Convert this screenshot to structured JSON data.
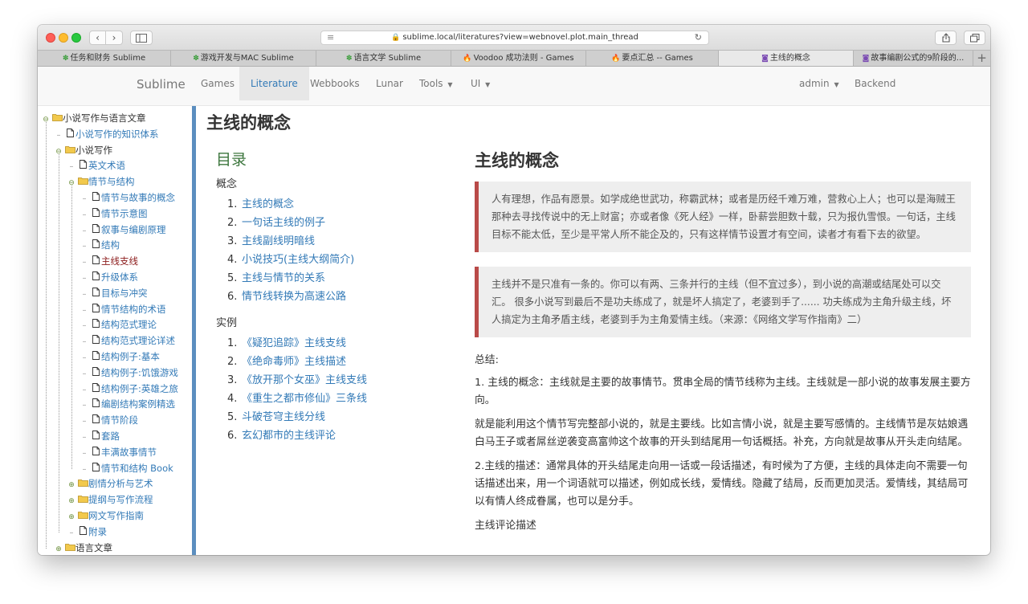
{
  "browser": {
    "url_prefix": "sublime.local",
    "url_path": "/literatures?view=webnovel.plot.main_thread",
    "tabs": [
      {
        "icon": "✽",
        "label": "任务和财务 Sublime",
        "active": false
      },
      {
        "icon": "✽",
        "label": "游戏开发与MAC Sublime",
        "active": false
      },
      {
        "icon": "✽",
        "label": "语言文学 Sublime",
        "active": false
      },
      {
        "icon": "🔥",
        "label": "Voodoo 成功法则 - Games",
        "active": false
      },
      {
        "icon": "🔥",
        "label": "要点汇总 -- Games",
        "active": false
      },
      {
        "icon": "◙",
        "label": "主线的概念",
        "active": true
      },
      {
        "icon": "◙",
        "label": "故事编剧公式的9阶段的...",
        "active": false
      }
    ],
    "new_tab": "+"
  },
  "navbar": {
    "brand": "Sublime",
    "items": [
      "Games",
      "Literature",
      "Webbooks",
      "Lunar",
      "Tools",
      "UI"
    ],
    "user": "admin",
    "backend": "Backend"
  },
  "tree": {
    "items": [
      {
        "label": "小说写作与语言文章",
        "type": "folder-open",
        "level": 0,
        "link": false
      },
      {
        "label": "小说写作的知识体系",
        "type": "file",
        "level": 1,
        "link": true
      },
      {
        "label": "小说写作",
        "type": "folder-open",
        "level": 1,
        "link": false
      },
      {
        "label": "英文术语",
        "type": "file",
        "level": 2,
        "link": true
      },
      {
        "label": "情节与结构",
        "type": "folder-open",
        "level": 2,
        "link": true
      },
      {
        "label": "情节与故事的概念",
        "type": "file",
        "level": 3,
        "link": true
      },
      {
        "label": "情节示意图",
        "type": "file",
        "level": 3,
        "link": true
      },
      {
        "label": "叙事与编剧原理",
        "type": "file",
        "level": 3,
        "link": true
      },
      {
        "label": "结构",
        "type": "file",
        "level": 3,
        "link": true
      },
      {
        "label": "主线支线",
        "type": "file",
        "level": 3,
        "link": true,
        "current": true
      },
      {
        "label": "升级体系",
        "type": "file",
        "level": 3,
        "link": true
      },
      {
        "label": "目标与冲突",
        "type": "file",
        "level": 3,
        "link": true
      },
      {
        "label": "情节结构的术语",
        "type": "file",
        "level": 3,
        "link": true
      },
      {
        "label": "结构范式理论",
        "type": "file",
        "level": 3,
        "link": true
      },
      {
        "label": "结构范式理论详述",
        "type": "file",
        "level": 3,
        "link": true
      },
      {
        "label": "结构例子:基本",
        "type": "file",
        "level": 3,
        "link": true
      },
      {
        "label": "结构例子:饥饿游戏",
        "type": "file",
        "level": 3,
        "link": true
      },
      {
        "label": "结构例子:英雄之旅",
        "type": "file",
        "level": 3,
        "link": true
      },
      {
        "label": "编剧结构案例精选",
        "type": "file",
        "level": 3,
        "link": true
      },
      {
        "label": "情节阶段",
        "type": "file",
        "level": 3,
        "link": true
      },
      {
        "label": "套路",
        "type": "file",
        "level": 3,
        "link": true
      },
      {
        "label": "丰满故事情节",
        "type": "file",
        "level": 3,
        "link": true
      },
      {
        "label": "情节和结构 Book",
        "type": "file",
        "level": 3,
        "link": true
      },
      {
        "label": "剧情分析与艺术",
        "type": "folder",
        "level": 2,
        "link": true
      },
      {
        "label": "提纲与写作流程",
        "type": "folder",
        "level": 2,
        "link": true
      },
      {
        "label": "网文写作指南",
        "type": "folder",
        "level": 2,
        "link": true
      },
      {
        "label": "附录",
        "type": "file",
        "level": 2,
        "link": true
      },
      {
        "label": "语言文章",
        "type": "folder",
        "level": 1,
        "link": false
      }
    ]
  },
  "page": {
    "title": "主线的概念"
  },
  "toc": {
    "title": "目录",
    "sections": [
      {
        "label": "概念",
        "items": [
          "主线的概念",
          "一句话主线的例子",
          "主线副线明暗线",
          "小说技巧(主线大纲简介)",
          "主线与情节的关系",
          "情节线转换为高速公路"
        ]
      },
      {
        "label": "实例",
        "items": [
          "《疑犯追踪》主线支线",
          "《绝命毒师》主线描述",
          "《放开那个女巫》主线支线",
          "《重生之都市修仙》三条线",
          "斗破苍穹主线分线",
          "玄幻都市的主线评论"
        ]
      }
    ]
  },
  "article": {
    "title": "主线的概念",
    "quotes": [
      "人有理想，作品有愿景。如学成绝世武功，称霸武林；或者是历经千难万难，营救心上人；也可以是海贼王那种去寻找传说中的无上财富；亦或者像《死人经》一样，卧薪尝胆数十载，只为报仇雪恨。一句话，主线目标不能太低，至少是平常人所不能企及的，只有这样情节设置才有空间，读者才有看下去的欲望。",
      "主线并不是只准有一条的。你可以有两、三条并行的主线（但不宜过多），到小说的高潮或结尾处可以交汇。 很多小说写到最后不是功夫练成了，就是坏人搞定了，老婆到手了...... 功夫练成为主角升级主线，坏人搞定为主角矛盾主线，老婆到手为主角爱情主线。（来源：《网络文学写作指南》二）"
    ],
    "summary_label": "总结:",
    "paragraphs": [
      "1. 主线的概念：主线就是主要的故事情节。贯串全局的情节线称为主线。主线就是一部小说的故事发展主要方向。",
      "就是能利用这个情节写完整部小说的，就是主要线。比如言情小说，就是主要写感情的。主线情节是灰姑娘遇白马王子或者屌丝逆袭变高富帅这个故事的开头到结尾用一句话概括。补充，方向就是故事从开头走向结尾。",
      "2.主线的描述：通常具体的开头结尾走向用一话或一段话描述，有时候为了方便，主线的具体走向不需要一句话描述出来，用一个词语就可以描述，例如成长线，爱情线。隐藏了结局，反而更加灵活。爱情线，其结局可以有情人终成眷属，也可以是分手。",
      "主线评论描述"
    ]
  },
  "colors": {
    "link": "#337ab7",
    "toc_title": "#3c763d",
    "quote_border": "#b94a48",
    "divider": "#5b8ebf",
    "current_tree_item": "#8b1a1a"
  }
}
